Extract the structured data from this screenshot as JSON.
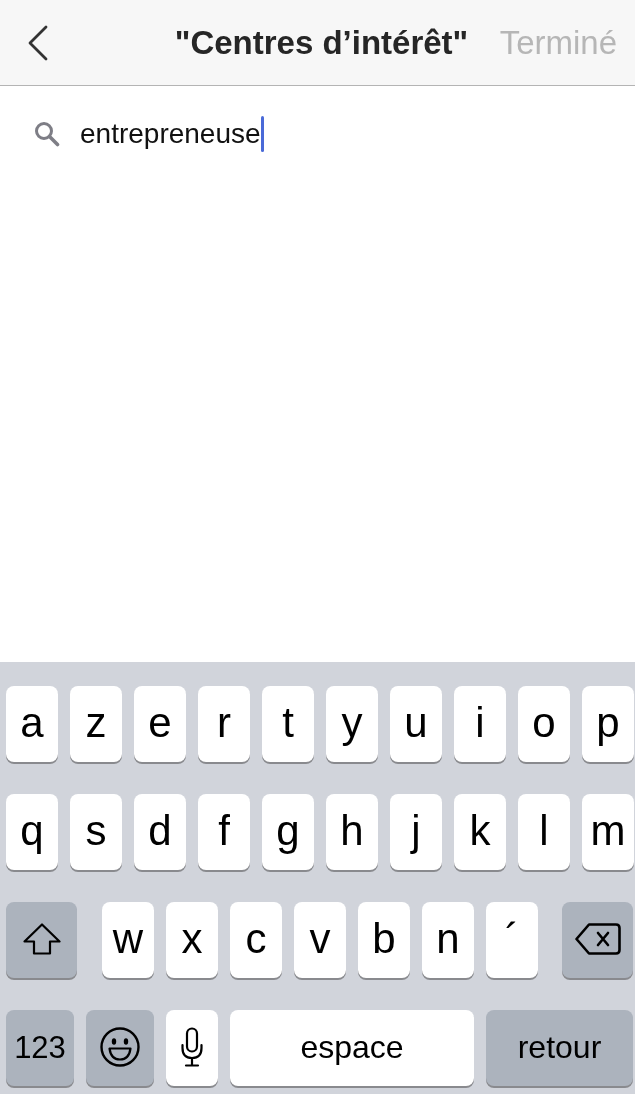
{
  "header": {
    "title": "\"Centres d’intérêt\"",
    "done": {
      "label": "Terminé",
      "disabled": true
    }
  },
  "search": {
    "value": "entrepreneuse",
    "focused": true
  },
  "keyboard": {
    "rows": [
      {
        "keys": [
          {
            "kind": "letter",
            "label": "a"
          },
          {
            "kind": "letter",
            "label": "z"
          },
          {
            "kind": "letter",
            "label": "e"
          },
          {
            "kind": "letter",
            "label": "r"
          },
          {
            "kind": "letter",
            "label": "t"
          },
          {
            "kind": "letter",
            "label": "y"
          },
          {
            "kind": "letter",
            "label": "u"
          },
          {
            "kind": "letter",
            "label": "i"
          },
          {
            "kind": "letter",
            "label": "o"
          },
          {
            "kind": "letter",
            "label": "p"
          }
        ]
      },
      {
        "keys": [
          {
            "kind": "letter",
            "label": "q"
          },
          {
            "kind": "letter",
            "label": "s"
          },
          {
            "kind": "letter",
            "label": "d"
          },
          {
            "kind": "letter",
            "label": "f"
          },
          {
            "kind": "letter",
            "label": "g"
          },
          {
            "kind": "letter",
            "label": "h"
          },
          {
            "kind": "letter",
            "label": "j"
          },
          {
            "kind": "letter",
            "label": "k"
          },
          {
            "kind": "letter",
            "label": "l"
          },
          {
            "kind": "letter",
            "label": "m"
          }
        ]
      },
      {
        "keys": [
          {
            "kind": "shift"
          },
          {
            "kind": "letter",
            "label": "w"
          },
          {
            "kind": "letter",
            "label": "x"
          },
          {
            "kind": "letter",
            "label": "c"
          },
          {
            "kind": "letter",
            "label": "v"
          },
          {
            "kind": "letter",
            "label": "b"
          },
          {
            "kind": "letter",
            "label": "n"
          },
          {
            "kind": "accent",
            "label": "´"
          },
          {
            "kind": "delete"
          }
        ]
      },
      {
        "keys": [
          {
            "kind": "mode",
            "label": "123"
          },
          {
            "kind": "emoji"
          },
          {
            "kind": "dictation"
          },
          {
            "kind": "space",
            "label": "espace"
          },
          {
            "kind": "return",
            "label": "retour"
          }
        ]
      }
    ]
  }
}
